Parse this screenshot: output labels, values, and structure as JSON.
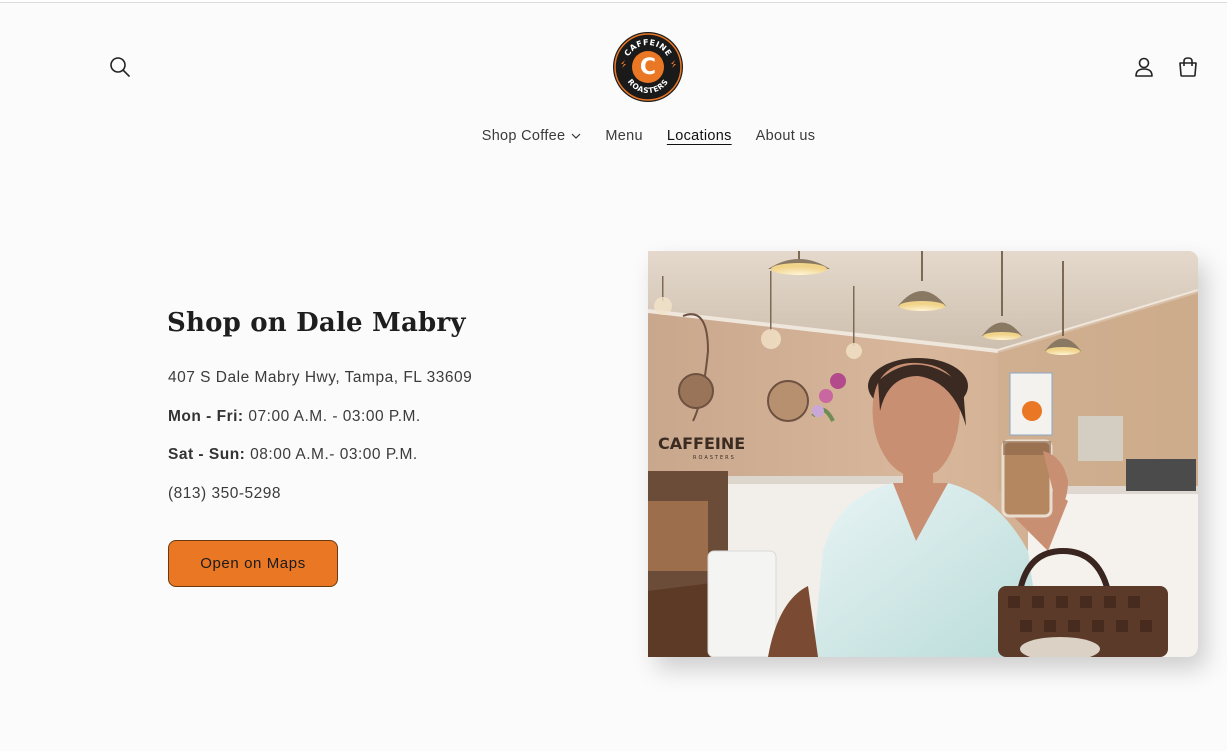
{
  "header": {
    "logo_alt": "Caffeine Roasters",
    "logo_top_text": "CAFFEINE",
    "logo_bottom_text": "ROASTERS",
    "logo_letter": "C"
  },
  "nav": {
    "items": [
      {
        "label": "Shop Coffee",
        "has_dropdown": true
      },
      {
        "label": "Menu"
      },
      {
        "label": "Locations",
        "active": true
      },
      {
        "label": "About us"
      }
    ]
  },
  "location": {
    "title": "Shop on Dale Mabry",
    "address": "407 S Dale Mabry Hwy, Tampa, FL 33609",
    "weekday_label": "Mon - Fri:",
    "weekday_hours": "07:00 A.M. - 03:00 P.M.",
    "weekend_label": "Sat - Sun:",
    "weekend_hours": "08:00 A.M.- 03:00 P.M.",
    "phone": "(813) 350-5298",
    "maps_button": "Open on Maps"
  },
  "photo": {
    "wall_sign": "CAFFEINE",
    "wall_sign_sub": "ROASTERS"
  },
  "colors": {
    "accent": "#ea7724",
    "background": "#fbfbfb",
    "text": "#333333"
  }
}
